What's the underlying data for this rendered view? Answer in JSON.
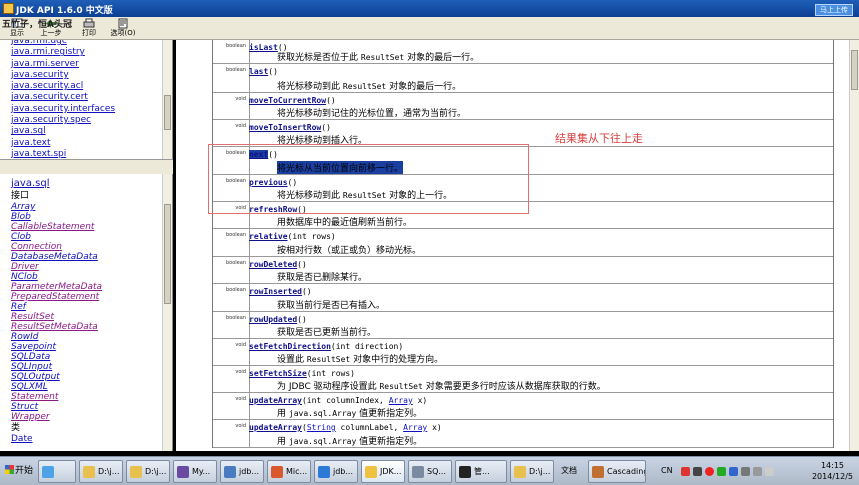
{
  "window": {
    "title": "JDK API 1.6.0 中文版",
    "upload_label": "马上上传",
    "overlay_user": "五竹子，恒A头冠"
  },
  "toolbar": [
    {
      "label": "显示",
      "icon": "show-icon"
    },
    {
      "label": "上一步",
      "icon": "back-icon"
    },
    {
      "label": "打印",
      "icon": "print-icon"
    },
    {
      "label": "选项(O)",
      "icon": "options-icon"
    }
  ],
  "left_top": {
    "packages": [
      "java.rmi.dgc",
      "java.rmi.registry",
      "java.rmi.server",
      "java.security",
      "java.security.acl",
      "java.security.cert",
      "java.security.interfaces",
      "java.security.spec",
      "java.sql",
      "java.text",
      "java.text.spi"
    ]
  },
  "left_bottom": {
    "package_title": "java.sql",
    "interfaces_heading": "接口",
    "interfaces": [
      "Array",
      "Blob",
      "CallableStatement",
      "Clob",
      "Connection",
      "DatabaseMetaData",
      "Driver",
      "NClob",
      "ParameterMetaData",
      "PreparedStatement",
      "Ref",
      "ResultSet",
      "ResultSetMetaData",
      "RowId",
      "Savepoint",
      "SQLData",
      "SQLInput",
      "SQLOutput",
      "SQLXML",
      "Statement",
      "Struct",
      "Wrapper"
    ],
    "classes_heading": "类",
    "classes": [
      "Date"
    ]
  },
  "methods": [
    {
      "ret": "boolean",
      "name": "isLast",
      "params": "()",
      "desc": [
        "获取光标是否位于此 ",
        "ResultSet",
        " 对象的最后一行。"
      ]
    },
    {
      "ret": "boolean",
      "name": "last",
      "params": "()",
      "desc": [
        "将光标移动到此 ",
        "ResultSet",
        " 对象的最后一行。"
      ]
    },
    {
      "ret": "void",
      "name": "moveToCurrentRow",
      "params": "()",
      "desc": [
        "将光标移动到记住的光标位置，通常为当前行。",
        "",
        ""
      ]
    },
    {
      "ret": "void",
      "name": "moveToInsertRow",
      "params": "()",
      "desc": [
        "将光标移动到插入行。",
        "",
        ""
      ]
    },
    {
      "ret": "boolean",
      "name": "next",
      "params": "()",
      "desc": [
        "将光标从当前位置向前移一行。",
        "",
        ""
      ]
    },
    {
      "ret": "boolean",
      "name": "previous",
      "params": "()",
      "desc": [
        "将光标移动到此 ",
        "ResultSet",
        " 对象的上一行。"
      ]
    },
    {
      "ret": "void",
      "name": "refreshRow",
      "params": "()",
      "desc": [
        "用数据库中的最近值刷新当前行。",
        "",
        ""
      ]
    },
    {
      "ret": "boolean",
      "name": "relative",
      "params": "(int rows)",
      "desc": [
        "按相对行数（或正或负）移动光标。",
        "",
        ""
      ]
    },
    {
      "ret": "boolean",
      "name": "rowDeleted",
      "params": "()",
      "desc": [
        "获取是否已删除某行。",
        "",
        ""
      ]
    },
    {
      "ret": "boolean",
      "name": "rowInserted",
      "params": "()",
      "desc": [
        "获取当前行是否已有插入。",
        "",
        ""
      ]
    },
    {
      "ret": "boolean",
      "name": "rowUpdated",
      "params": "()",
      "desc": [
        "获取是否已更新当前行。",
        "",
        ""
      ]
    },
    {
      "ret": "void",
      "name": "setFetchDirection",
      "params": "(int direction)",
      "desc": [
        "设置此 ",
        "ResultSet",
        " 对象中行的处理方向。"
      ]
    },
    {
      "ret": "void",
      "name": "setFetchSize",
      "params": "(int rows)",
      "desc": [
        "为 JDBC 驱动程序设置此 ",
        "ResultSet",
        " 对象需要更多行时应该从数据库获取的行数。"
      ]
    },
    {
      "ret": "void",
      "name": "updateArray",
      "params": "(int columnIndex, ",
      "ptype": "Array",
      "params_end": " x)",
      "desc": [
        "用 ",
        "java.sql.Array",
        " 值更新指定列。"
      ]
    },
    {
      "ret": "void",
      "name": "updateArray",
      "params": "(",
      "ptype": "String",
      "params_mid": " columnLabel, ",
      "ptype2": "Array",
      "params_end": " x)",
      "desc": [
        "用 ",
        "java.sql.Array",
        " 值更新指定列。"
      ]
    }
  ],
  "annotation": {
    "text": "结果集从下往上走"
  },
  "taskbar": {
    "start_label": "开始",
    "buttons": [
      {
        "label": "",
        "icon": "ie-app-icon",
        "color": "#4da3e6"
      },
      {
        "label": "D:\\j...",
        "icon": "folder-icon",
        "color": "#e8c050"
      },
      {
        "label": "D:\\j...",
        "icon": "folder-icon",
        "color": "#e8c050"
      },
      {
        "label": "My...",
        "icon": "eclipse-icon",
        "color": "#6a4aa0"
      },
      {
        "label": "jdb...",
        "icon": "doc-icon",
        "color": "#4a7ac0"
      },
      {
        "label": "Mic...",
        "icon": "ppt-icon",
        "color": "#d9582c"
      },
      {
        "label": "jdb...",
        "icon": "ie-icon",
        "color": "#2b7ad6"
      },
      {
        "label": "JDK...",
        "icon": "help-icon",
        "color": "#f0c040"
      },
      {
        "label": "SQ...",
        "icon": "sql-icon",
        "color": "#7a8aa0"
      },
      {
        "label": "管...",
        "icon": "cmd-icon",
        "color": "#222222"
      },
      {
        "label": "D:\\j...",
        "icon": "folder-icon",
        "color": "#e8c050"
      },
      {
        "label": "文档",
        "icon": "",
        "color": ""
      },
      {
        "label": "Cascading S",
        "icon": "css-icon",
        "color": "#c07030"
      }
    ],
    "lang": "CN",
    "time": "14:15",
    "date": "2014/12/5"
  }
}
